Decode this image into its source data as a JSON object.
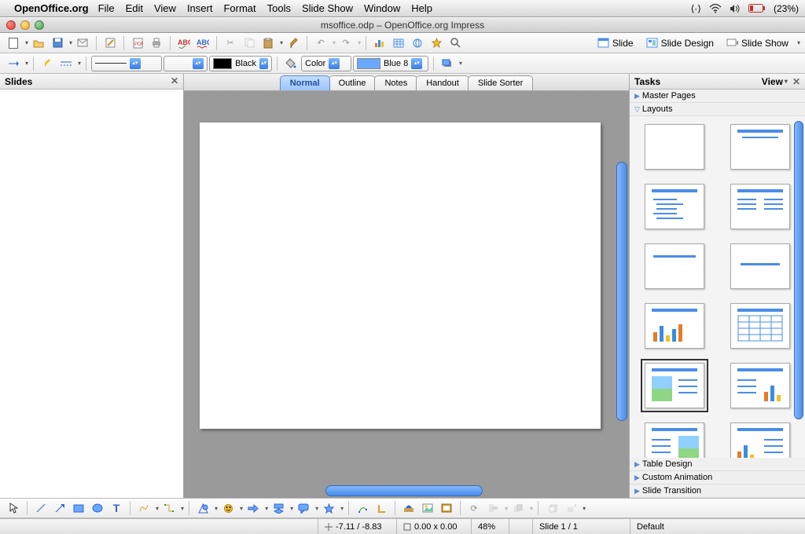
{
  "menubar": {
    "apple": "",
    "appname": "OpenOffice.org",
    "items": [
      "File",
      "Edit",
      "View",
      "Insert",
      "Format",
      "Tools",
      "Slide Show",
      "Window",
      "Help"
    ],
    "status": {
      "battery_pct": "(23%)",
      "wifi": "wifi-icon",
      "volume": "volume-icon",
      "sync": "sync-icon"
    }
  },
  "window": {
    "title": "msoffice.odp – OpenOffice.org Impress"
  },
  "toolbar1": {
    "slide": "Slide",
    "slide_design": "Slide Design",
    "slide_show": "Slide Show"
  },
  "toolbar2": {
    "black_label": "Black",
    "color_label": "Color",
    "blue_label": "Blue 8",
    "line_width": "",
    "line_width_unit": ""
  },
  "slides_panel": {
    "title": "Slides"
  },
  "view_tabs": [
    "Normal",
    "Outline",
    "Notes",
    "Handout",
    "Slide Sorter"
  ],
  "active_view_tab": 0,
  "tasks_panel": {
    "title": "Tasks",
    "view_label": "View",
    "sections": [
      "Master Pages",
      "Layouts",
      "Table Design",
      "Custom Animation",
      "Slide Transition"
    ],
    "expanded_section": 1,
    "selected_layout_index": 8
  },
  "statusbar": {
    "coords": "-7.11 / -8.83",
    "size": "0.00 x 0.00",
    "zoom": "48%",
    "slide_of": "Slide 1 / 1",
    "template": "Default"
  }
}
